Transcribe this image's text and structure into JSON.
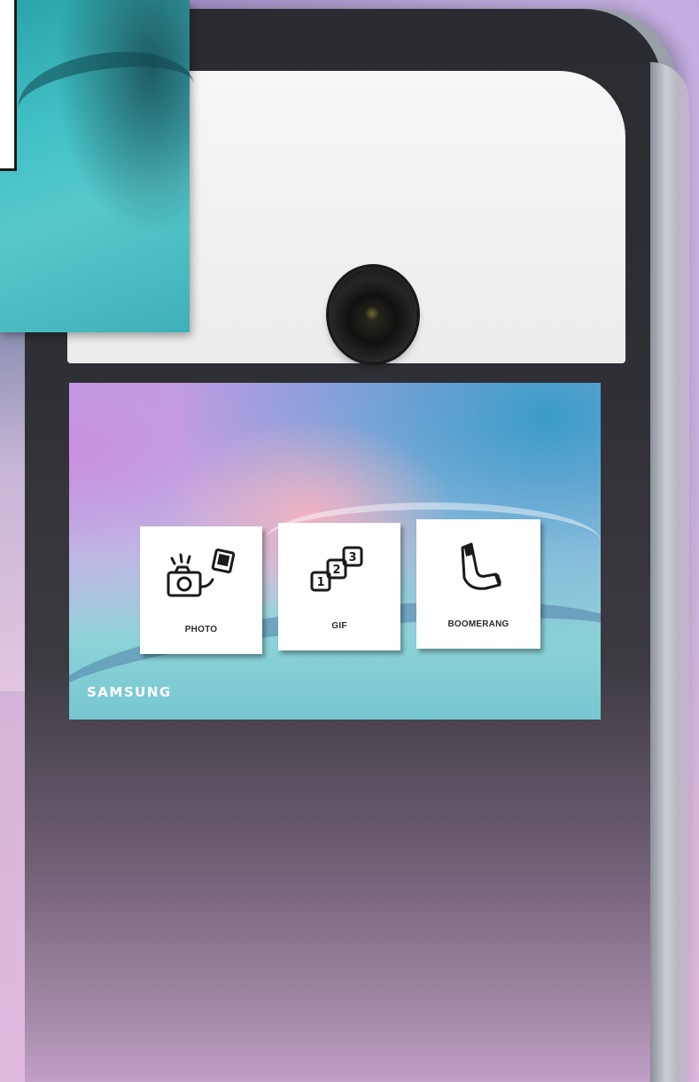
{
  "screen": {
    "modes": [
      {
        "label": "PHOTO",
        "icon": "camera-with-print-icon"
      },
      {
        "label": "GIF",
        "icon": "numbered-frames-icon"
      },
      {
        "label": "BOOMERANG",
        "icon": "boomerang-icon"
      }
    ],
    "brand": "SAMSUNG"
  },
  "colors": {
    "kiosk_body": "#2f3035",
    "camera_panel": "#f3f3f3",
    "tile_background": "#ffffff",
    "tile_text": "#2b2b2b",
    "brand_text": "#ffffff"
  }
}
